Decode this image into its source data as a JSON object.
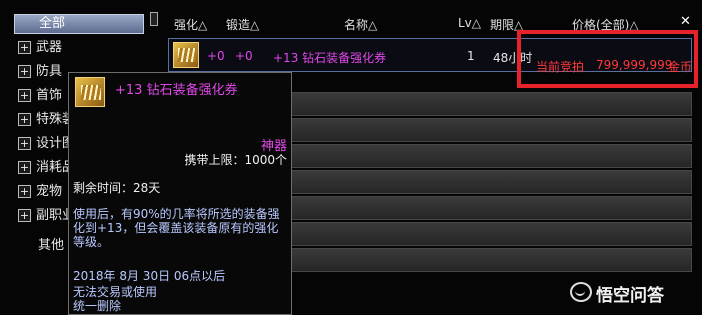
{
  "sidebar": {
    "all": "全部",
    "items": [
      {
        "label": "武器",
        "expander": "+"
      },
      {
        "label": "防具",
        "expander": "+"
      },
      {
        "label": "首饰",
        "expander": "+"
      },
      {
        "label": "特殊装备",
        "expander": "+"
      },
      {
        "label": "设计图",
        "expander": "+"
      },
      {
        "label": "消耗品",
        "expander": "+"
      },
      {
        "label": "宠物",
        "expander": "+"
      },
      {
        "label": "副职业",
        "expander": "+"
      }
    ],
    "other": "其他"
  },
  "header": {
    "enhance": "强化△",
    "forge": "锻造△",
    "name": "名称△",
    "level": "Lv△",
    "expiry": "期限△",
    "price": "价格(全部)△",
    "close": "✕"
  },
  "listing": {
    "enhance": "+0",
    "forge": "+0",
    "name": "+13 钻石装备强化券",
    "level": "1",
    "expiry": "48小时",
    "bid_label": "当前竞拍",
    "bid_price": "799,999,999",
    "bid_unit": "金币"
  },
  "tooltip": {
    "title": "+13 钻石装备强化券",
    "rarity": "神器",
    "cap": "携带上限：1000个",
    "remaining": "剩余时间：28天",
    "description": "使用后，有90%的几率将所选的装备强化到+13，但会覆盖该装备原有的强化等级。",
    "date": "2018年 8月 30日 06点以后",
    "trade": "无法交易或使用",
    "delete": "统一删除"
  },
  "watermark": {
    "text": "悟空问答",
    "icon": "speech-bubble-icon"
  },
  "colors": {
    "rare_magenta": "#e048e8",
    "highlight_red": "#e8222b",
    "desc_blue": "#b9c9ff"
  }
}
